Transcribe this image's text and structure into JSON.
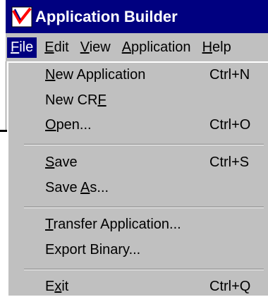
{
  "window": {
    "title": "Application Builder",
    "icon": "checkmark-app-icon"
  },
  "menubar": [
    {
      "pre": "",
      "key": "F",
      "post": "ile"
    },
    {
      "pre": "",
      "key": "E",
      "post": "dit"
    },
    {
      "pre": "",
      "key": "V",
      "post": "iew"
    },
    {
      "pre": "",
      "key": "A",
      "post": "pplication"
    },
    {
      "pre": "",
      "key": "H",
      "post": "elp"
    }
  ],
  "file_menu": {
    "items": [
      {
        "pre": "",
        "key": "N",
        "post": "ew Application",
        "shortcut": "Ctrl+N"
      },
      {
        "pre": "New CR",
        "key": "F",
        "post": "",
        "shortcut": ""
      },
      {
        "pre": "",
        "key": "O",
        "post": "pen...",
        "shortcut": "Ctrl+O"
      },
      {
        "pre": "",
        "key": "S",
        "post": "ave",
        "shortcut": "Ctrl+S"
      },
      {
        "pre": "Save ",
        "key": "A",
        "post": "s...",
        "shortcut": ""
      },
      {
        "pre": "",
        "key": "T",
        "post": "ransfer Application...",
        "shortcut": ""
      },
      {
        "pre": "Export Binary...",
        "key": "",
        "post": "",
        "shortcut": ""
      },
      {
        "pre": "E",
        "key": "x",
        "post": "it",
        "shortcut": "Ctrl+Q"
      }
    ]
  },
  "colors": {
    "titlebar": "#000080",
    "menu_background": "#c0c0c0",
    "highlight": "#000080"
  }
}
